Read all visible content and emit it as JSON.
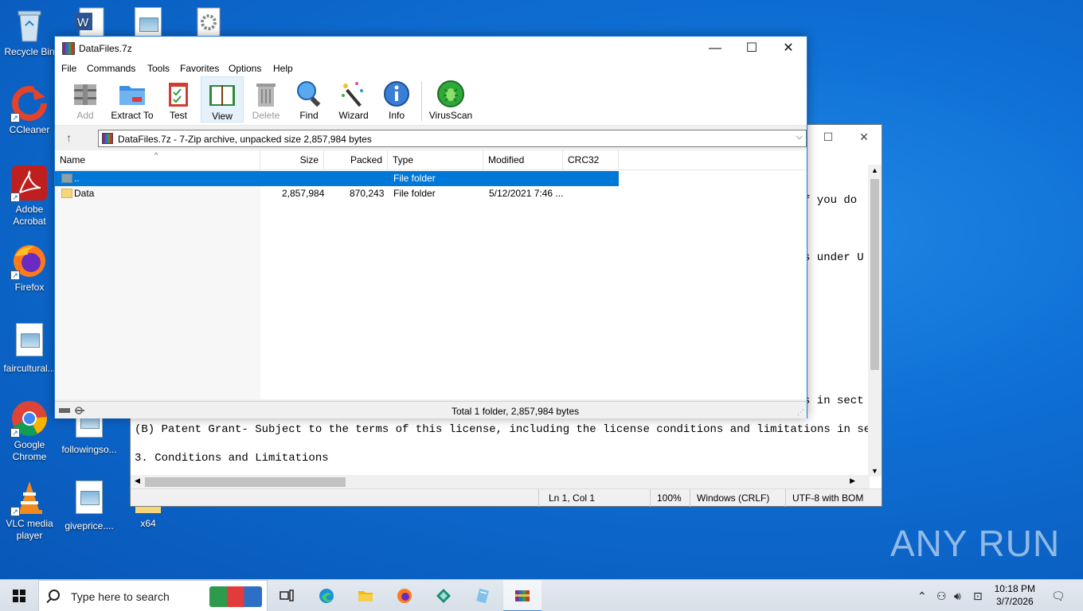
{
  "desktop": {
    "icons": [
      {
        "label": "Recycle Bin"
      },
      {
        "label": "CCleaner"
      },
      {
        "label": "Adobe Acrobat"
      },
      {
        "label": "Firefox"
      },
      {
        "label": "faircultural..."
      },
      {
        "label": "Google Chrome"
      },
      {
        "label": "VLC media player"
      },
      {
        "label": "followingso..."
      },
      {
        "label": "giveprice...."
      },
      {
        "label": "x64"
      }
    ],
    "watermark": "ANY RUN"
  },
  "notepad": {
    "lines": [
      "f you do",
      "s under U",
      "s in sect",
      "(B) Patent Grant- Subject to the terms of this license, including the license conditions and limitations in section",
      "3. Conditions and Limitations"
    ],
    "status": {
      "position": "Ln 1, Col 1",
      "zoom": "100%",
      "line_ending": "Windows (CRLF)",
      "encoding": "UTF-8 with BOM"
    }
  },
  "winrar": {
    "title": "DataFiles.7z",
    "menu": [
      "File",
      "Commands",
      "Tools",
      "Favorites",
      "Options",
      "Help"
    ],
    "toolbar": [
      {
        "label": "Add",
        "icon": "add-archive-icon",
        "disabled": true
      },
      {
        "label": "Extract To",
        "icon": "extract-folder-icon"
      },
      {
        "label": "Test",
        "icon": "test-clipboard-icon"
      },
      {
        "label": "View",
        "icon": "view-book-icon",
        "active": true
      },
      {
        "label": "Delete",
        "icon": "trash-icon",
        "disabled": true
      },
      {
        "label": "Find",
        "icon": "magnifier-icon"
      },
      {
        "label": "Wizard",
        "icon": "magic-wand-icon"
      },
      {
        "label": "Info",
        "icon": "info-icon"
      },
      {
        "label": "VirusScan",
        "icon": "virus-scan-icon"
      }
    ],
    "address": "DataFiles.7z - 7-Zip archive, unpacked size 2,857,984 bytes",
    "columns": [
      "Name",
      "Size",
      "Packed",
      "Type",
      "Modified",
      "CRC32"
    ],
    "rows": [
      {
        "name": "..",
        "size": "",
        "packed": "",
        "type": "File folder",
        "modified": "",
        "crc": ""
      },
      {
        "name": "Data",
        "size": "2,857,984",
        "packed": "870,243",
        "type": "File folder",
        "modified": "5/12/2021 7:46 ...",
        "crc": ""
      }
    ],
    "status": "Total 1 folder, 2,857,984 bytes"
  },
  "taskbar": {
    "search_placeholder": "Type here to search",
    "time": "10:18 PM",
    "date": "3/7/2026"
  },
  "colors": {
    "selection": "#0078d7",
    "desktop": "#0f6fd4",
    "window_border": "#1e7ad4"
  }
}
